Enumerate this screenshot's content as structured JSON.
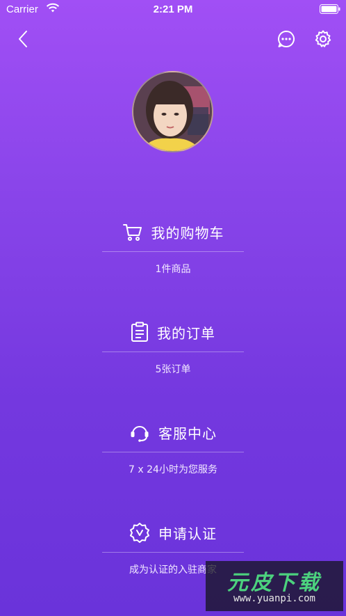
{
  "status_bar": {
    "carrier": "Carrier",
    "time": "2:21 PM"
  },
  "nav": {
    "icons": [
      "back-chevron-icon",
      "chat-bubble-icon",
      "gear-icon"
    ]
  },
  "menu": [
    {
      "title": "我的购物车",
      "subtitle": "1件商品",
      "icon": "cart-icon"
    },
    {
      "title": "我的订单",
      "subtitle": "5张订单",
      "icon": "clipboard-icon"
    },
    {
      "title": "客服中心",
      "subtitle": "7 x 24小时为您服务",
      "icon": "headset-icon"
    },
    {
      "title": "申请认证",
      "subtitle": "成为认证的入驻商家",
      "icon": "verified-badge-icon"
    }
  ],
  "watermark": {
    "brand": "元皮下载",
    "url": "www.yuanpi.com"
  },
  "colors": {
    "gradient_top": "#a14ff5",
    "gradient_bottom": "#6a33da",
    "text": "#ffffff"
  }
}
